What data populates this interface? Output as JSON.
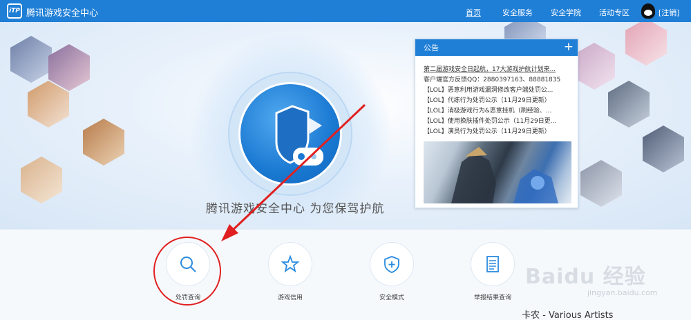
{
  "header": {
    "logo_text": "iTP",
    "site_title": "腾讯游戏安全中心",
    "nav": [
      {
        "label": "首页"
      },
      {
        "label": "安全服务"
      },
      {
        "label": "安全学院"
      },
      {
        "label": "活动专区"
      }
    ],
    "logout_label": "[注销]"
  },
  "hero": {
    "tagline": "腾讯游戏安全中心 为您保驾护航"
  },
  "notice": {
    "title": "公告",
    "plus": "+",
    "items": [
      "第二届游戏安全日起航，17大游戏护航计划来...",
      "客户端官方反馈QQ：2880397163、88881835",
      "【LOL】恶意利用游戏漏洞修改客户端处罚公...",
      "【LOL】代练行为处罚公示（11月29日更新）",
      "【LOL】消极游戏行为&恶意挂机（刷经验、...",
      "【LOL】使用换肤插件处罚公示（11月29日更...",
      "【LOL】演员行为处罚公示（11月29日更新）"
    ]
  },
  "services": [
    {
      "label": "处罚查询",
      "icon": "search-icon"
    },
    {
      "label": "游戏信用",
      "icon": "star-icon"
    },
    {
      "label": "安全模式",
      "icon": "shield-plus-icon"
    },
    {
      "label": "举报结果查询",
      "icon": "document-icon"
    }
  ],
  "watermark": {
    "baidu": "Baidu 经验",
    "site": "jingyan.baidu.com",
    "artist": "卡农 - Various Artists"
  },
  "colors": {
    "brand_blue": "#1f7fd6",
    "annotation_red": "#e02020"
  }
}
